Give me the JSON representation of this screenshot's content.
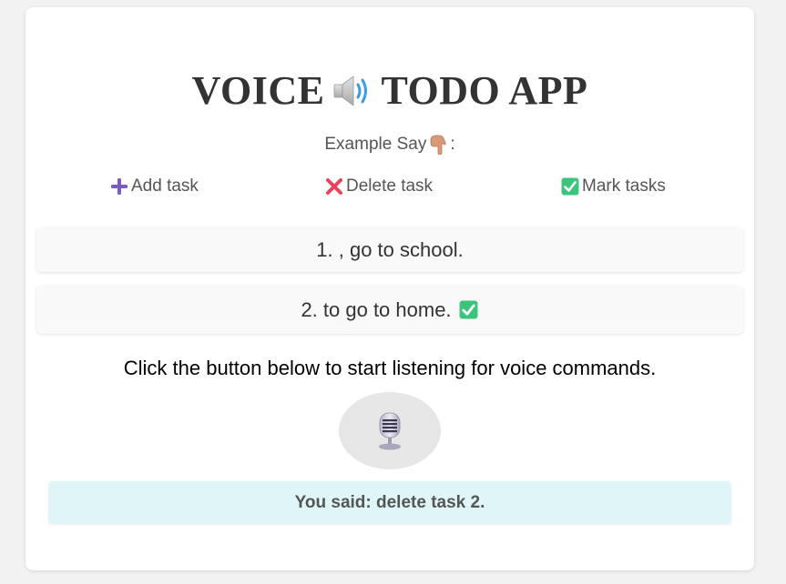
{
  "app": {
    "title_part1": "VOICE",
    "title_part2": "TODO APP",
    "title_icon": "speaker-icon"
  },
  "example": {
    "label": "Example Say",
    "suffix": ":",
    "icon": "pointing-down-hand-icon"
  },
  "commands": [
    {
      "icon": "plus-icon",
      "label": "Add task",
      "icon_color": "#7b5cc4"
    },
    {
      "icon": "cross-mark-icon",
      "label": "Delete task",
      "icon_color": "#e8435a"
    },
    {
      "icon": "check-mark-icon",
      "label": "Mark tasks",
      "icon_color": "#3cc47c"
    }
  ],
  "tasks": [
    {
      "text": "1. , go to school.",
      "done": false
    },
    {
      "text": "2. to go to home.",
      "done": true
    }
  ],
  "instructions": "Click the button below to start listening for voice commands.",
  "mic": {
    "icon": "microphone-icon"
  },
  "transcript": "You said: delete task 2.",
  "colors": {
    "background": "#f2f2f2",
    "card": "#ffffff",
    "task_bg": "#f9f9f9",
    "transcript_bg": "#dff5f7",
    "mic_button": "#e6e6e6"
  }
}
